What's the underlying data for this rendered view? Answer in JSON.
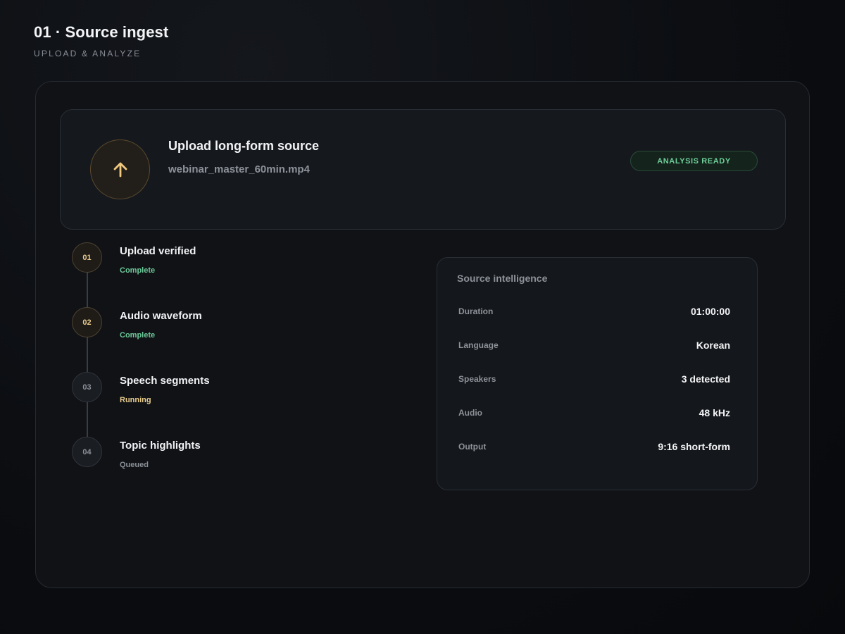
{
  "header": {
    "title": "01 · Source ingest",
    "subtitle": "UPLOAD & ANALYZE"
  },
  "upload": {
    "icon": "arrow-up-icon",
    "title": "Upload long-form source",
    "filename": "webinar_master_60min.mp4",
    "status_badge": "ANALYSIS READY"
  },
  "steps": [
    {
      "number": "01",
      "title": "Upload verified",
      "status": "Complete",
      "state": "complete"
    },
    {
      "number": "02",
      "title": "Audio waveform",
      "status": "Complete",
      "state": "complete"
    },
    {
      "number": "03",
      "title": "Speech segments",
      "status": "Running",
      "state": "running"
    },
    {
      "number": "04",
      "title": "Topic highlights",
      "status": "Queued",
      "state": "queued"
    }
  ],
  "intelligence": {
    "title": "Source intelligence",
    "rows": [
      {
        "label": "Duration",
        "value": "01:00:00"
      },
      {
        "label": "Language",
        "value": "Korean"
      },
      {
        "label": "Speakers",
        "value": "3 detected"
      },
      {
        "label": "Audio",
        "value": "48 kHz"
      },
      {
        "label": "Output",
        "value": "9:16 short-form"
      }
    ]
  },
  "colors": {
    "accent": "#e8c98c",
    "success": "#6dc999",
    "running": "#e9cd8e",
    "background": "#0b0d11"
  }
}
